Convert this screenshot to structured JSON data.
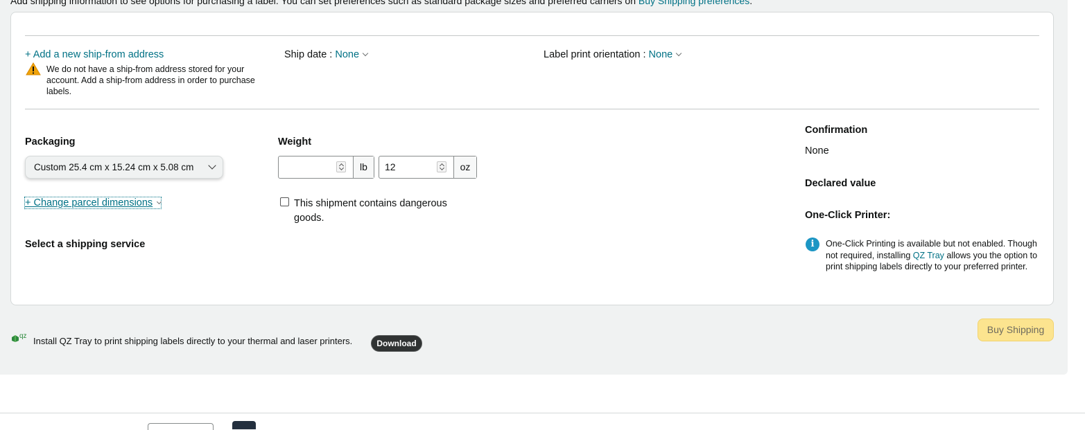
{
  "top_info": {
    "text": "Add shipping information to see options for purchasing a label. You can set preferences such as standard package sizes and preferred carriers on",
    "link": "Buy Shipping preferences",
    "suffix": "."
  },
  "ship_from": {
    "add_link": "+ Add a new ship-from address",
    "warning_icon": "warning-triangle-icon",
    "warning_text": "We do not have a ship-from address stored for your account. Add a ship-from address in order to purchase labels."
  },
  "ship_date": {
    "label": "Ship date :",
    "value": "None"
  },
  "label_orientation": {
    "label": "Label print orientation :",
    "value": "None"
  },
  "packaging": {
    "label": "Packaging",
    "selected": "Custom 25.4 cm x 15.24 cm x 5.08 cm",
    "change_link": "+ Change parcel dimensions"
  },
  "weight": {
    "label": "Weight",
    "lb_value": "",
    "lb_unit": "lb",
    "oz_value": "12",
    "oz_unit": "oz"
  },
  "dangerous_goods": {
    "label": "This shipment contains dangerous goods.",
    "checked": false
  },
  "shipping_service": {
    "label": "Select a shipping service"
  },
  "confirmation": {
    "label": "Confirmation",
    "value": "None"
  },
  "declared_value": {
    "label": "Declared value"
  },
  "one_click": {
    "label": "One-Click Printer:",
    "info_icon": "info-icon",
    "info_text_1": "One-Click Printing is available but not enabled. Though not required, installing",
    "info_link": "QZ Tray",
    "info_text_2": "allows you the option to print shipping labels directly to your preferred printer."
  },
  "buy_button": {
    "label": "Buy Shipping",
    "color": "#fce48f"
  },
  "qz_banner": {
    "logo_text": "qz",
    "text": "Install QZ Tray to print shipping labels directly to your thermal and laser printers.",
    "download_label": "Download"
  },
  "colors": {
    "link": "#007185",
    "panel": "#f0f2f2",
    "info": "#1c96c4",
    "warning": "#f0a30a"
  }
}
